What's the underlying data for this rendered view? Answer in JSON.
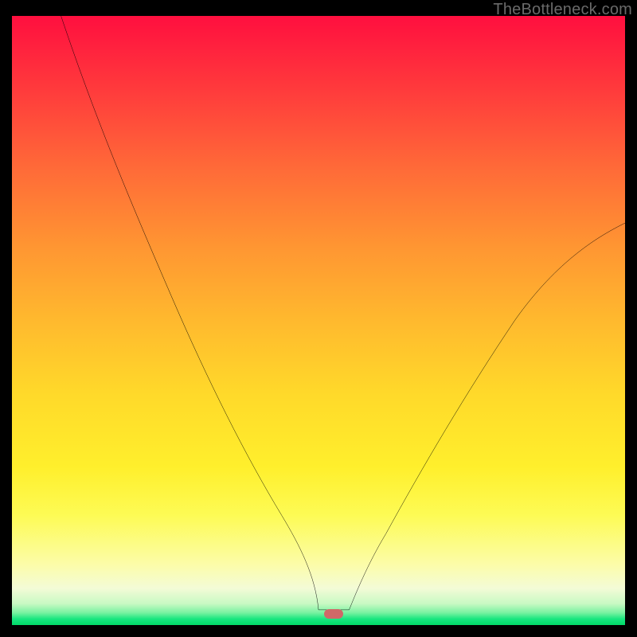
{
  "watermark": "TheBottleneck.com",
  "marker": {
    "color": "#d06868",
    "x_frac": 0.525,
    "y_frac": 0.985
  },
  "chart_data": {
    "type": "line",
    "title": "",
    "xlabel": "",
    "ylabel": "",
    "xlim": [
      0,
      100
    ],
    "ylim": [
      0,
      100
    ],
    "grid": false,
    "series": [
      {
        "name": "bottleneck-curve",
        "x": [
          8,
          12,
          16,
          20,
          24,
          28,
          32,
          36,
          40,
          44,
          48,
          50,
          53,
          55,
          58,
          62,
          66,
          70,
          74,
          78,
          82,
          86,
          90,
          94,
          98,
          100
        ],
        "y": [
          100,
          90,
          80,
          71,
          62,
          53,
          45,
          37,
          30,
          23,
          16,
          11,
          5,
          2,
          2,
          5,
          10,
          16,
          22,
          29,
          36,
          43,
          50,
          57,
          63,
          66
        ]
      }
    ],
    "annotations": [
      {
        "type": "marker",
        "x": 52.5,
        "y": 1.5,
        "label": "optimal-point"
      }
    ],
    "background_gradient": {
      "direction": "vertical",
      "stops": [
        {
          "pos": 0.0,
          "color": "#ff0f3f"
        },
        {
          "pos": 0.25,
          "color": "#ff6a38"
        },
        {
          "pos": 0.5,
          "color": "#ffb92e"
        },
        {
          "pos": 0.74,
          "color": "#ffef2c"
        },
        {
          "pos": 0.9,
          "color": "#fcfca8"
        },
        {
          "pos": 0.98,
          "color": "#77f2a0"
        },
        {
          "pos": 1.0,
          "color": "#00d968"
        }
      ]
    }
  }
}
